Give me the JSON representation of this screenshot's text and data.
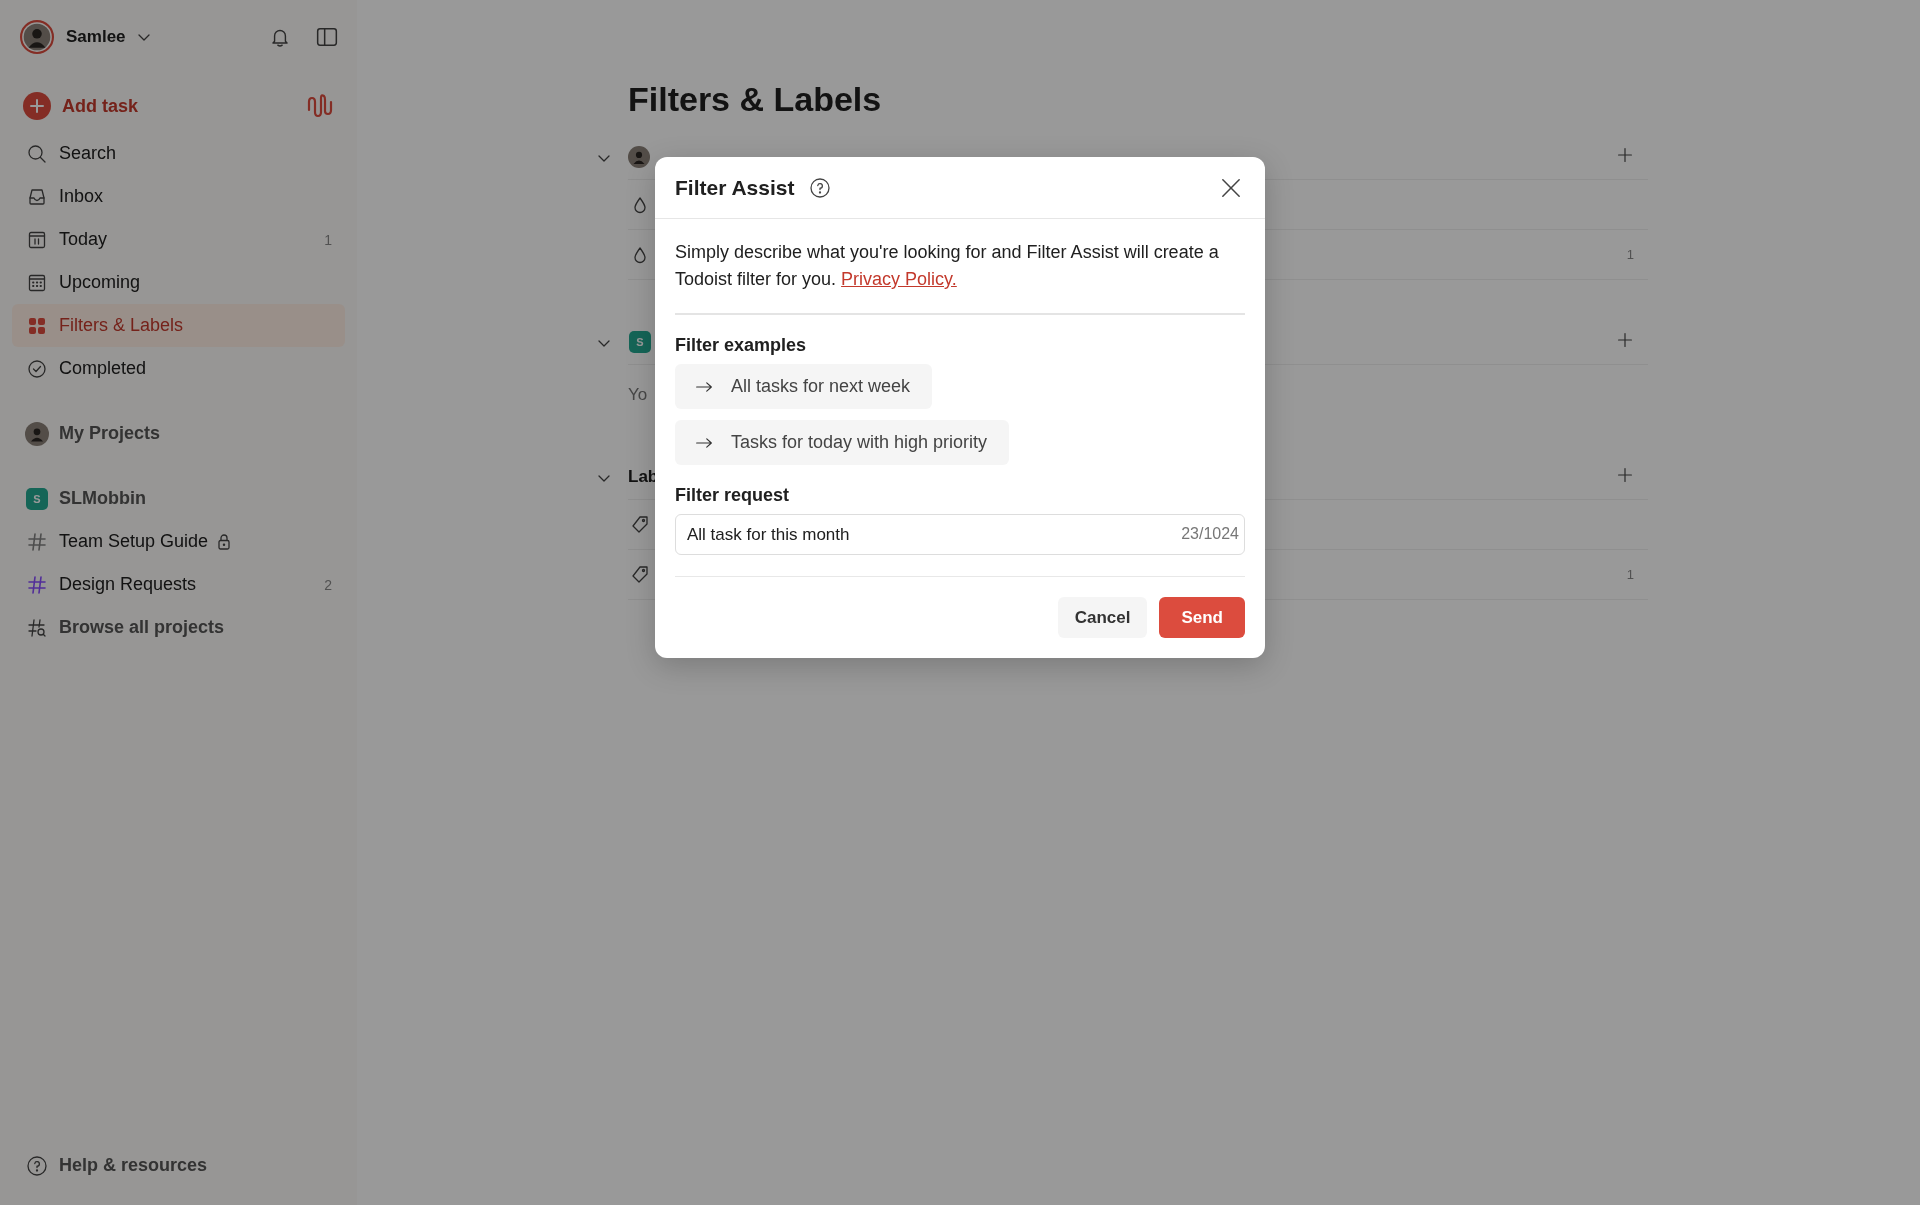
{
  "sidebar": {
    "user": {
      "name": "Samlee"
    },
    "add_task": {
      "label": "Add task"
    },
    "nav": [
      {
        "label": "Search",
        "selected": false
      },
      {
        "label": "Inbox",
        "selected": false
      },
      {
        "label": "Today",
        "count": "1",
        "selected": false
      },
      {
        "label": "Upcoming",
        "selected": false
      },
      {
        "label": "Filters & Labels",
        "selected": true
      },
      {
        "label": "Completed",
        "selected": false
      }
    ],
    "my_projects": {
      "label": "My Projects"
    },
    "workspace": {
      "label": "SLMobbin",
      "badge": "S"
    },
    "projects": [
      {
        "label": "Team Setup Guide",
        "locked": true,
        "color": "#4d4d4d"
      },
      {
        "label": "Design Requests",
        "count": "2",
        "locked": false,
        "color": "#522e99"
      }
    ],
    "browse": {
      "label": "Browse all projects"
    },
    "help": {
      "label": "Help & resources"
    }
  },
  "main": {
    "title": "Filters & Labels",
    "sections": [
      {
        "kind": "avatar",
        "rows": [
          {
            "kind": "filter"
          },
          {
            "kind": "filter",
            "count": "1"
          }
        ]
      },
      {
        "kind": "workspace",
        "badge": "S",
        "note": "Yo"
      },
      {
        "kind": "plain",
        "title": "Lab",
        "rows": [
          {
            "kind": "label"
          },
          {
            "kind": "label",
            "count": "1"
          }
        ]
      }
    ]
  },
  "dialog": {
    "title": "Filter Assist",
    "description": "Simply describe what you're looking for and Filter Assist will create a Todoist filter for you.",
    "link": "Privacy Policy.",
    "examples_heading": "Filter examples",
    "examples": [
      "All tasks for next week",
      "Tasks for today with high priority"
    ],
    "request_heading": "Filter request",
    "request": {
      "value": "All task for this month",
      "counter": "23/1024"
    },
    "buttons": [
      {
        "label": "Cancel",
        "kind": "secondary"
      },
      {
        "label": "Send",
        "kind": "primary"
      }
    ]
  }
}
